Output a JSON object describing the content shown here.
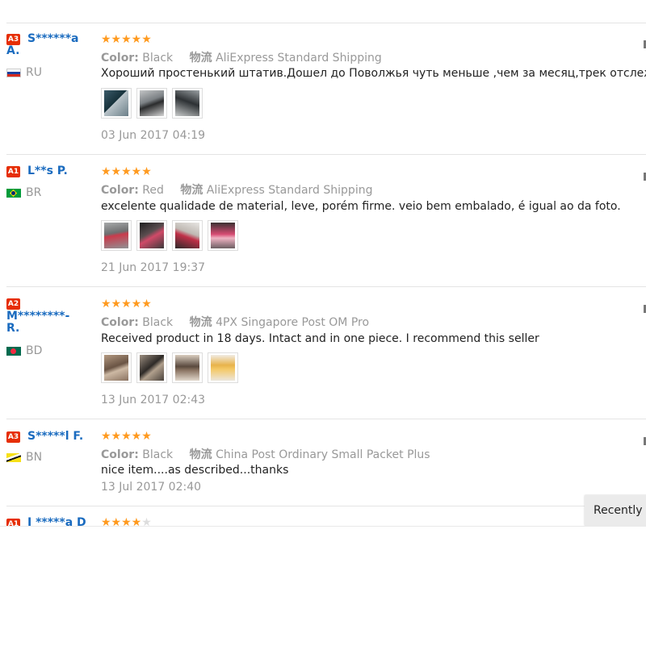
{
  "reviews": [
    {
      "level": "A3",
      "buyer": "S******a\nA.",
      "country": "RU",
      "rating": "★★★★★",
      "color_label": "Color:",
      "color_value": "Black",
      "shipping_label": "物流",
      "shipping_value": "AliExpress Standard Shipping",
      "comment": "Хороший простенький штатив.Дошел до Поволжья чуть меньше ,чем за месяц,трек отслеживался",
      "photos": [
        "photo-1",
        "photo-2",
        "photo-3"
      ],
      "date": "03 Jun 2017 04:19"
    },
    {
      "level": "A1",
      "buyer": "L**s P.",
      "country": "BR",
      "rating": "★★★★★",
      "color_label": "Color:",
      "color_value": "Red",
      "shipping_label": "物流",
      "shipping_value": "AliExpress Standard Shipping",
      "comment": "excelente qualidade de material, leve, porém firme. veio bem embalado, é igual ao da foto.",
      "photos": [
        "photo-1",
        "photo-2",
        "photo-3",
        "photo-4"
      ],
      "date": "21 Jun 2017 19:37"
    },
    {
      "level": "A2",
      "buyer": "M********-\nR.",
      "country": "BD",
      "rating": "★★★★★",
      "color_label": "Color:",
      "color_value": "Black",
      "shipping_label": "物流",
      "shipping_value": "4PX Singapore Post OM Pro",
      "comment": "Received product in 18 days. Intact and in one piece. I recommend this seller",
      "photos": [
        "photo-1",
        "photo-2",
        "photo-3",
        "photo-4"
      ],
      "date": "13 Jun 2017 02:43"
    },
    {
      "level": "A3",
      "buyer": "S*****l F.",
      "country": "BN",
      "rating": "★★★★★",
      "color_label": "Color:",
      "color_value": "Black",
      "shipping_label": "物流",
      "shipping_value": "China Post Ordinary Small Packet Plus",
      "comment": "nice item....as described...thanks",
      "photos": [],
      "date": "13 Jul 2017 02:40"
    },
    {
      "level": "A1",
      "buyer": "I *****a D",
      "rating": "★★★★",
      "rating_empty": "★"
    }
  ],
  "recently_viewed_label": "Recently Viewed",
  "colors": {
    "level_badge": "#e62e04",
    "buyer_link": "#1a6bbf",
    "star": "#ff9a1f",
    "muted_text": "#999999",
    "divider": "#e4e4e4",
    "recently_viewed_bg": "#ebebeb"
  }
}
